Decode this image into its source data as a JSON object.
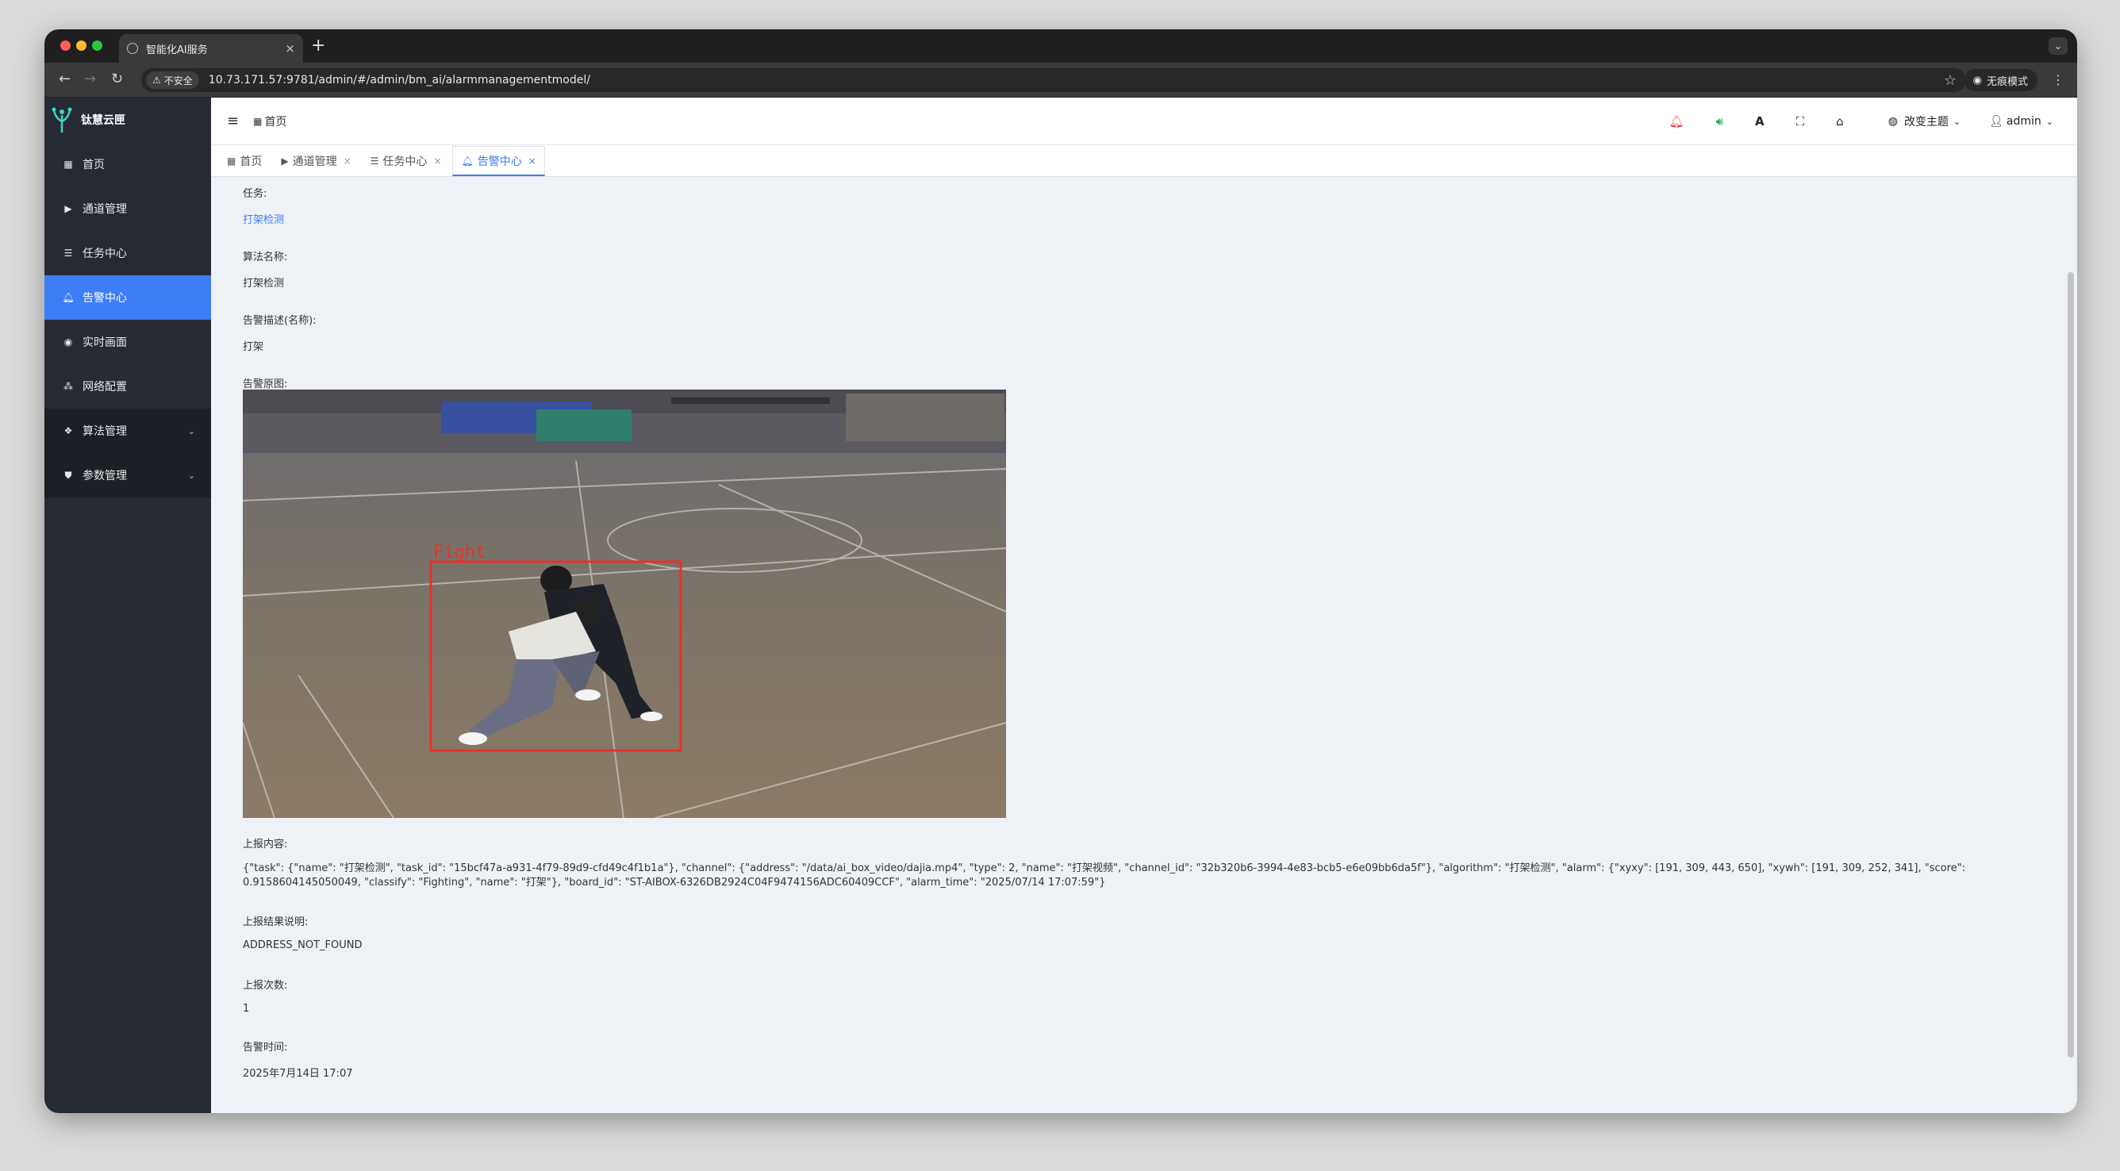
{
  "browser": {
    "tab_title": "智能化AI服务",
    "tab_close": "×",
    "new_tab": "+",
    "tab_menu": "⌄",
    "security_label": "不安全",
    "url": "10.73.171.57:9781/admin/#/admin/bm_ai/alarmmanagementmodel/",
    "incognito_label": "无痕模式"
  },
  "sidebar": {
    "brand": "钛慧云匣",
    "items": [
      {
        "label": "首页",
        "icon": "grid-icon"
      },
      {
        "label": "通道管理",
        "icon": "video-icon"
      },
      {
        "label": "任务中心",
        "icon": "list-icon"
      },
      {
        "label": "告警中心",
        "icon": "bell-icon"
      },
      {
        "label": "实时画面",
        "icon": "eye-icon"
      },
      {
        "label": "网络配置",
        "icon": "network-icon"
      },
      {
        "label": "算法管理",
        "icon": "cubes-icon"
      },
      {
        "label": "参数管理",
        "icon": "shield-icon"
      }
    ]
  },
  "topbar": {
    "breadcrumb": "首页",
    "theme_label": "改变主题",
    "user_label": "admin",
    "font_icon_label": "A"
  },
  "tabs": [
    {
      "label": "首页",
      "closable": false
    },
    {
      "label": "通道管理",
      "closable": true
    },
    {
      "label": "任务中心",
      "closable": true
    },
    {
      "label": "告警中心",
      "closable": true,
      "active": true
    }
  ],
  "detail": {
    "task_label": "任务:",
    "task_value": "打架检测",
    "algo_label": "算法名称:",
    "algo_value": "打架检测",
    "desc_label": "告警描述(名称):",
    "desc_value": "打架",
    "image_label": "告警原图:",
    "image_overlay_text": "Fight",
    "report_label": "上报内容:",
    "report_value": "{\"task\": {\"name\": \"打架检测\", \"task_id\": \"15bcf47a-a931-4f79-89d9-cfd49c4f1b1a\"}, \"channel\": {\"address\": \"/data/ai_box_video/dajia.mp4\", \"type\": 2, \"name\": \"打架视频\", \"channel_id\": \"32b320b6-3994-4e83-bcb5-e6e09bb6da5f\"}, \"algorithm\": \"打架检测\", \"alarm\": {\"xyxy\": [191, 309, 443, 650], \"xywh\": [191, 309, 252, 341], \"score\": 0.9158604145050049, \"classify\": \"Fighting\", \"name\": \"打架\"}, \"board_id\": \"ST-AIBOX-6326DB2924C04F9474156ADC60409CCF\", \"alarm_time\": \"2025/07/14 17:07:59\"}",
    "result_label": "上报结果说明:",
    "result_value": "ADDRESS_NOT_FOUND",
    "count_label": "上报次数:",
    "count_value": "1",
    "time_label": "告警时间:",
    "time_value": "2025年7月14日 17:07"
  },
  "colors": {
    "accent": "#3d7df5",
    "sidebar_bg": "#262a33",
    "content_bg": "#eef1f6",
    "detection_box": "#e8322a"
  }
}
